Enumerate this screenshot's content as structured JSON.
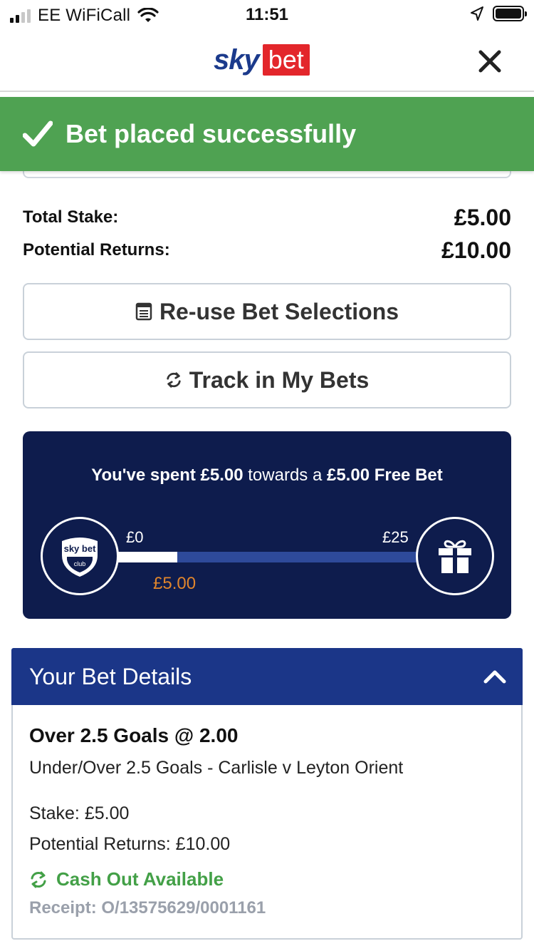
{
  "status_bar": {
    "carrier": "EE WiFiCall",
    "time": "11:51"
  },
  "header": {
    "logo_sky": "sky",
    "logo_bet": "bet",
    "brand_colors": {
      "sky_blue": "#1b3a8c",
      "bet_red": "#e3262b"
    }
  },
  "banner": {
    "message": "Bet placed successfully",
    "color": "#4fa252"
  },
  "totals": {
    "stake_label": "Total Stake:",
    "stake_value": "£5.00",
    "returns_label": "Potential Returns:",
    "returns_value": "£10.00"
  },
  "actions": {
    "reuse_label": "Re-use Bet Selections",
    "track_label": "Track in My Bets"
  },
  "promo": {
    "text_part1": "You've spent £5.00",
    "text_part2": " towards a ",
    "text_part3": "£5.00 Free Bet",
    "badge_line1": "sky bet",
    "badge_line2": "club",
    "min_label": "£0",
    "max_label": "£25",
    "current_label": "£5.00",
    "progress_fraction": 0.2,
    "background": "#0e1c4d",
    "accent": "#e0852c"
  },
  "bet_details": {
    "header": "Your Bet Details",
    "selection": "Over 2.5 Goals @ 2.00",
    "market": "Under/Over 2.5 Goals - Carlisle v Leyton Orient",
    "stake": "Stake: £5.00",
    "potential_returns": "Potential Returns: £10.00",
    "cashout": "Cash Out Available",
    "receipt": "Receipt: O/13575629/0001161",
    "header_color": "#1b3688"
  }
}
